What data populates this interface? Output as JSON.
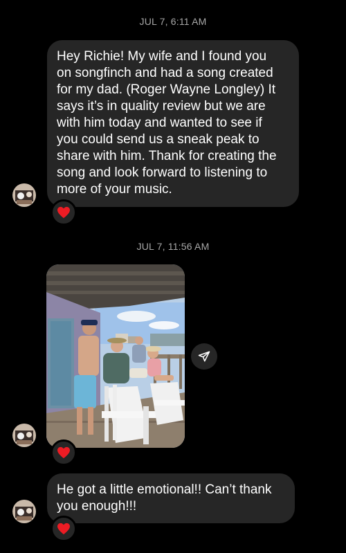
{
  "thread": {
    "timestamps": [
      "JUL 7, 6:11 AM",
      "JUL 7, 11:56 AM"
    ],
    "messages": [
      {
        "text": "Hey Richie! My wife and I found you\non songfinch and had a song created\nfor my dad. (Roger Wayne Longley) It\nsays it’s in quality review but we are\nwith him today and wanted to see if\nyou could send us a sneak peak to\nshare with him. Thank for creating the\nsong and look forward to listening to\nmore of your music.",
        "reaction": "heart"
      },
      {
        "type": "photo",
        "reaction": "heart",
        "icon": "send-icon"
      },
      {
        "text": "He got a little emotional!! Can’t thank\nyou enough!!!",
        "reaction": "heart"
      }
    ]
  },
  "colors": {
    "background": "#000000",
    "bubble": "#262626",
    "timestamp": "#a8a8a8",
    "heart": "#ed1c24"
  }
}
